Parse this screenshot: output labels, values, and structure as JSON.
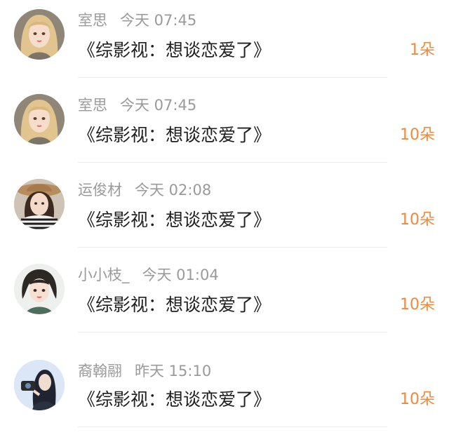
{
  "items": [
    {
      "name": "室思",
      "time": "今天 07:45",
      "title": "《综影视：想谈恋爱了》",
      "count": "1朵",
      "avatar_icon": "avatar-blonde-girl-icon"
    },
    {
      "name": "室思",
      "time": "今天 07:45",
      "title": "《综影视：想谈恋爱了》",
      "count": "10朵",
      "avatar_icon": "avatar-blonde-girl-icon"
    },
    {
      "name": "运俊材",
      "time": "今天 02:08",
      "title": "《综影视：想谈恋爱了》",
      "count": "10朵",
      "avatar_icon": "avatar-girl-hat-icon"
    },
    {
      "name": "小小枝_",
      "time": "今天 01:04",
      "title": "《综影视：想谈恋爱了》",
      "count": "10朵",
      "avatar_icon": "avatar-short-hair-girl-icon"
    },
    {
      "name": "裔翰翮",
      "time": "昨天 15:10",
      "title": "《综影视：想谈恋爱了》",
      "count": "10朵",
      "avatar_icon": "avatar-camera-girl-icon"
    }
  ],
  "colors": {
    "count": "#f08a3b",
    "name": "#9a9a9a",
    "title": "#1f1f1f",
    "divider": "#ededed"
  }
}
